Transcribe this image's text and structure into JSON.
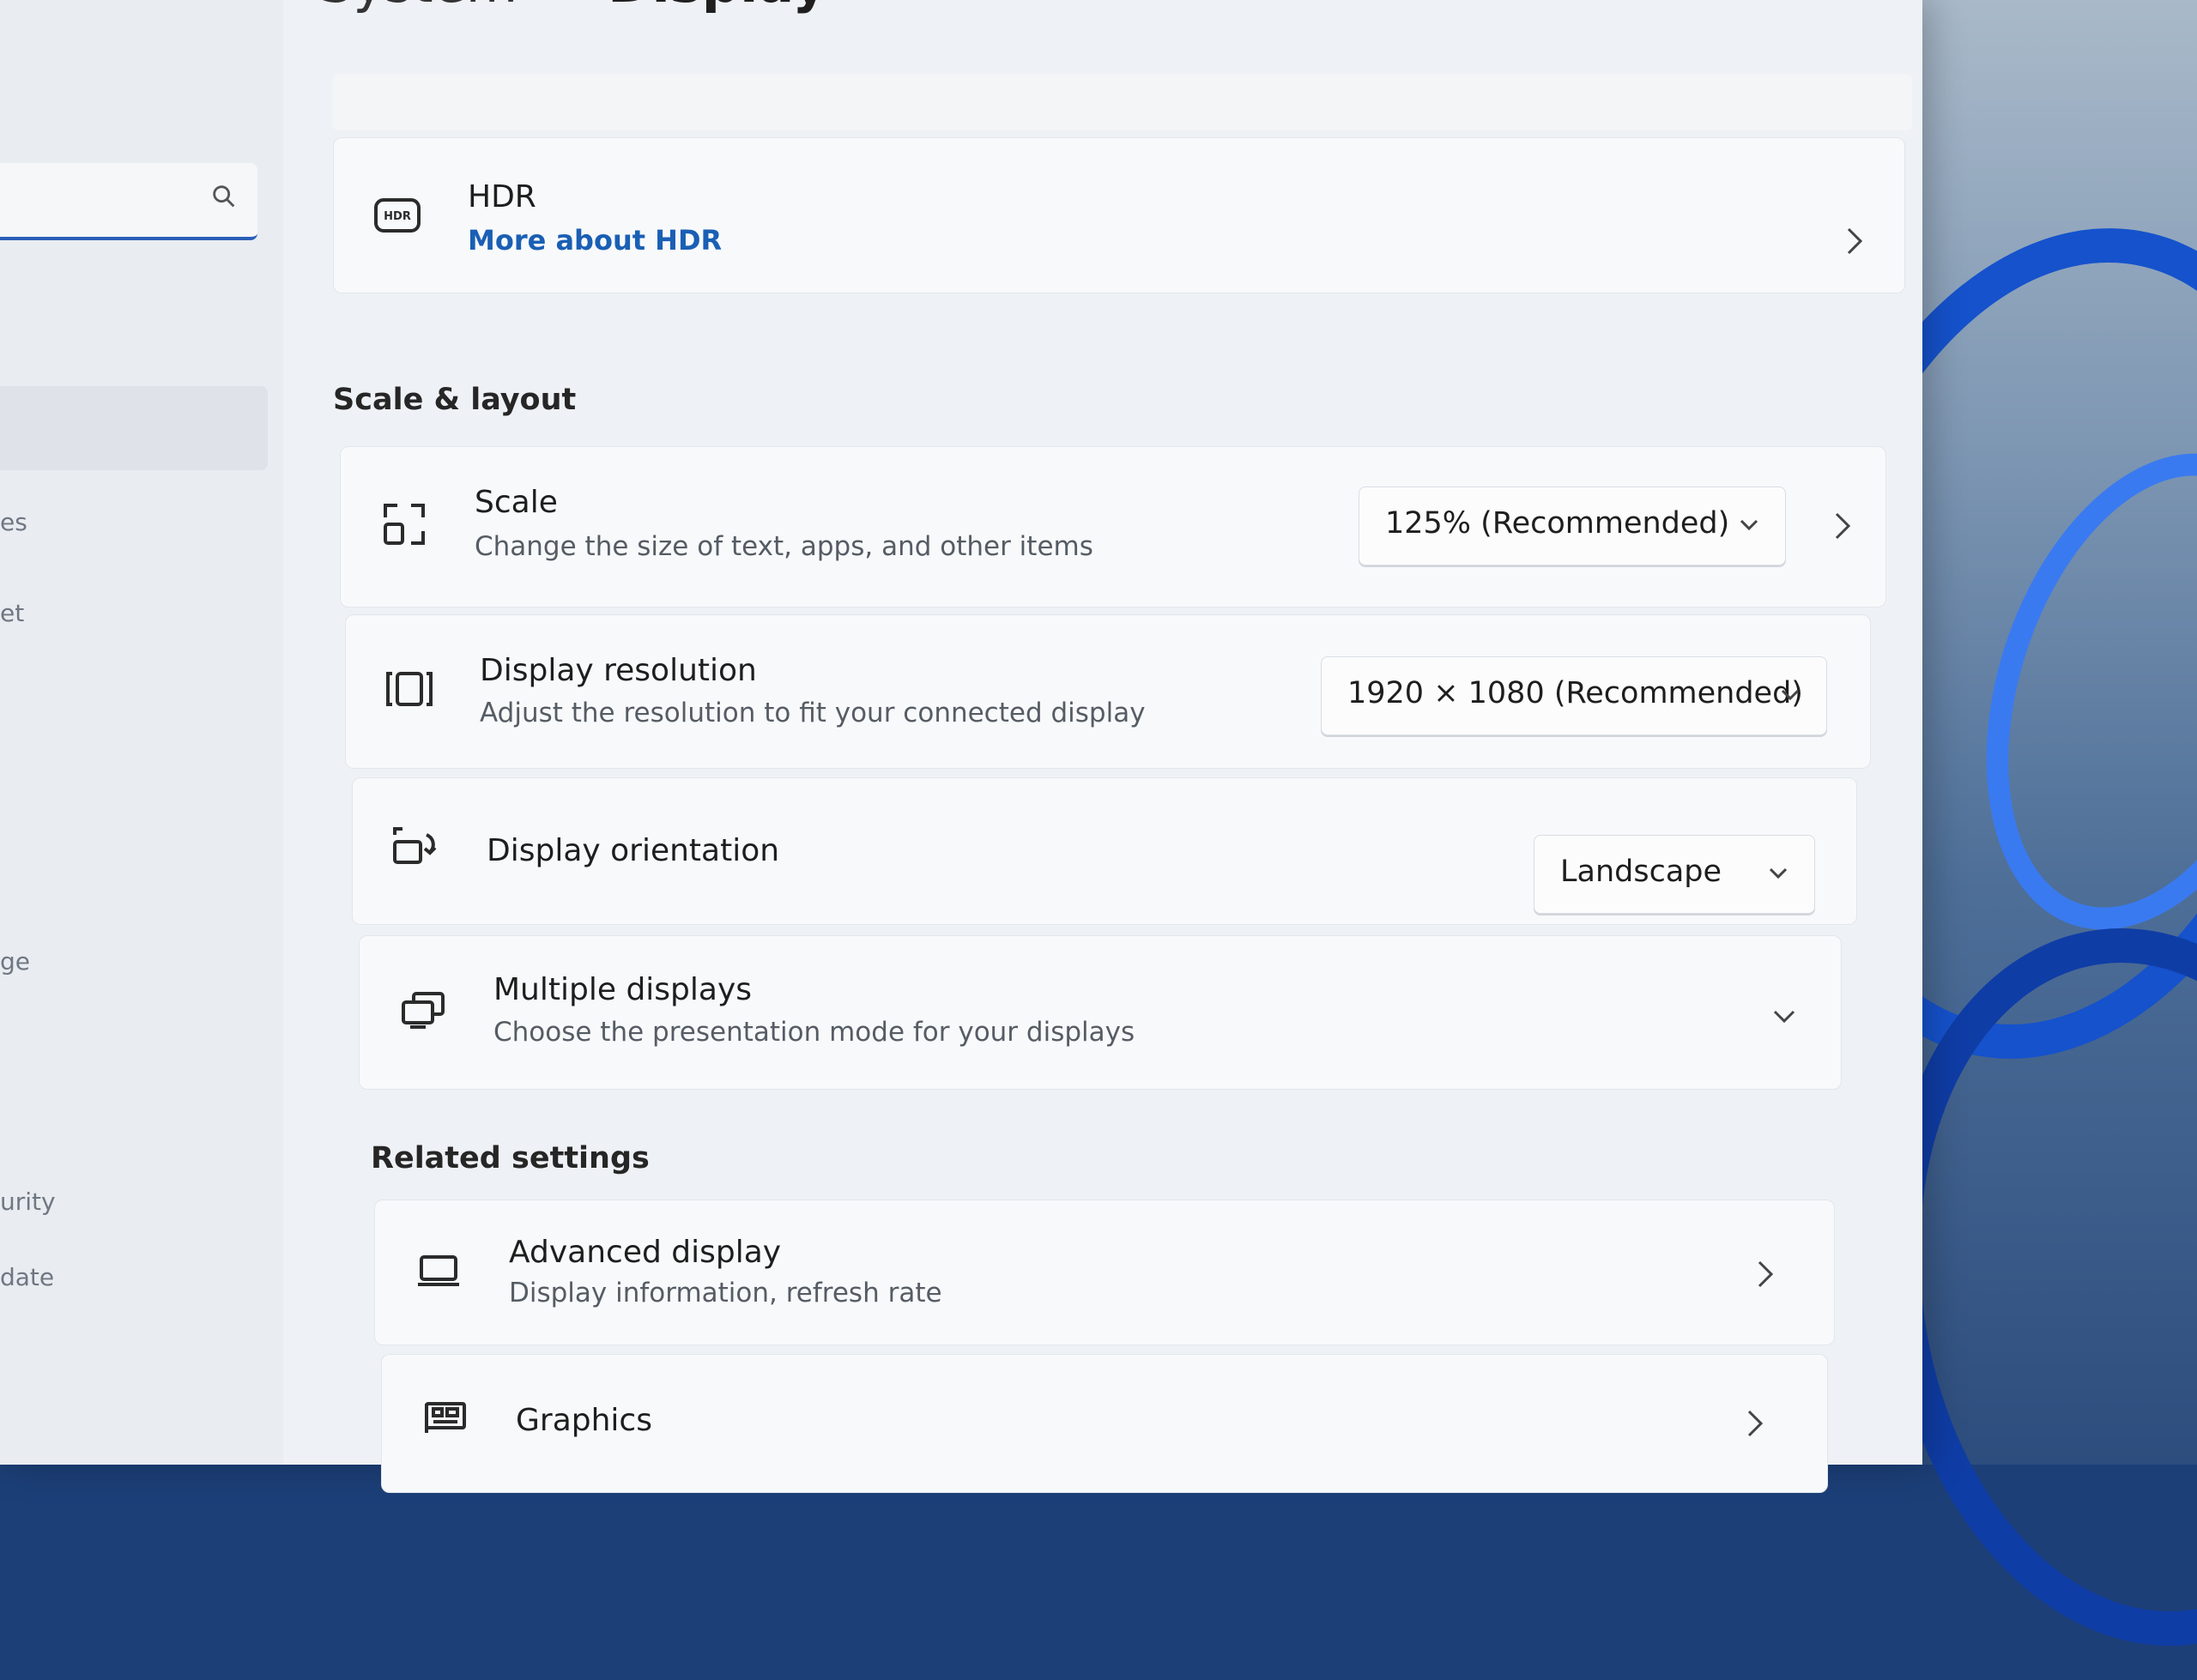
{
  "breadcrumb": {
    "parent": "System",
    "separator": ">",
    "current": "Display"
  },
  "sidebar": {
    "search_placeholder": "",
    "fragments": [
      "es",
      "et",
      "ge",
      "urity",
      "date"
    ]
  },
  "hdr": {
    "title": "HDR",
    "link": "More about HDR"
  },
  "sections": {
    "scale_layout": "Scale & layout",
    "related": "Related settings"
  },
  "scale": {
    "title": "Scale",
    "subtitle": "Change the size of text, apps, and other items",
    "value": "125% (Recommended)"
  },
  "resolution": {
    "title": "Display resolution",
    "subtitle": "Adjust the resolution to fit your connected display",
    "value": "1920 × 1080 (Recommended)"
  },
  "orientation": {
    "title": "Display orientation",
    "value": "Landscape"
  },
  "multiple": {
    "title": "Multiple displays",
    "subtitle": "Choose the presentation mode for your displays"
  },
  "advanced": {
    "title": "Advanced display",
    "subtitle": "Display information, refresh rate"
  },
  "graphics": {
    "title": "Graphics"
  },
  "colors": {
    "accent": "#1a5fb4",
    "window_bg": "#eef1f5",
    "card_bg": "#f8f9fb"
  }
}
